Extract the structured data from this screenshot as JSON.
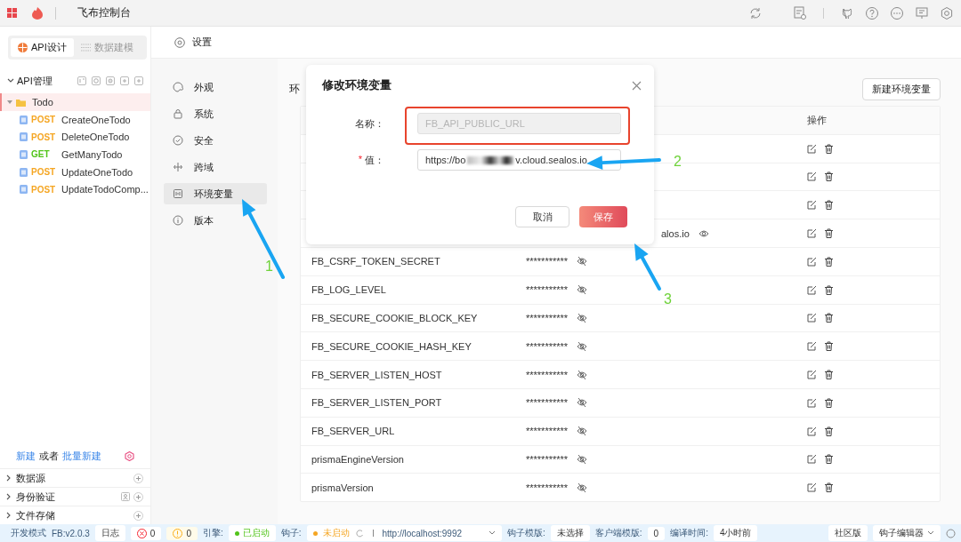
{
  "topbar": {
    "title": "飞布控制台"
  },
  "sidebar": {
    "tabs": [
      {
        "label": "API设计",
        "selected": true
      },
      {
        "label": "数据建模",
        "selected": false
      }
    ],
    "section": {
      "label": "API管理",
      "expanded": true
    },
    "tree": [
      {
        "label": "Todo",
        "selected": true,
        "expanded": true,
        "children": [
          {
            "method": "POST",
            "color": "#f5a623",
            "label": "CreateOneTodo",
            "selected": false
          },
          {
            "method": "POST",
            "color": "#f5a623",
            "label": "DeleteOneTodo",
            "selected": false
          },
          {
            "method": "GET",
            "color": "#52c41a",
            "label": "GetManyTodo",
            "selected": false
          },
          {
            "method": "POST",
            "color": "#f5a623",
            "label": "UpdateOneTodo",
            "selected": false
          },
          {
            "method": "POST",
            "color": "#f5a623",
            "label": "UpdateTodoComp..."
          }
        ]
      }
    ],
    "create_hint": {
      "link_1": "新建",
      "middle": "或者",
      "link_2": "批量新建"
    },
    "sections": [
      {
        "label": "数据源",
        "expanded": false,
        "kind": "plain"
      },
      {
        "label": "身份验证",
        "expanded": false,
        "kind": "user"
      },
      {
        "label": "文件存储",
        "expanded": false,
        "kind": "plain"
      }
    ]
  },
  "header": {
    "title": "设置"
  },
  "settings_nav": [
    {
      "label": "外观",
      "kind": "palette",
      "selected": false
    },
    {
      "label": "系统",
      "kind": "lock",
      "selected": false
    },
    {
      "label": "安全",
      "kind": "shield",
      "selected": false
    },
    {
      "label": "跨域",
      "kind": "cross",
      "selected": false
    },
    {
      "label": "环境变量",
      "kind": "env",
      "selected": true
    },
    {
      "label": "版本",
      "kind": "info",
      "selected": false
    }
  ],
  "table": {
    "title": "环",
    "new_button": "新建环境变量",
    "column_3": "操作",
    "rows": [
      {},
      {},
      {},
      {
        "value": "alos.io",
        "value_cut": true,
        "value_visible": true
      },
      {
        "name": "FB_CSRF_TOKEN_SECRET",
        "value": "***********",
        "value_visible": false
      },
      {
        "name": "FB_LOG_LEVEL",
        "value": "***********",
        "value_visible": false
      },
      {
        "name": "FB_SECURE_COOKIE_BLOCK_KEY",
        "value": "***********",
        "value_visible": false
      },
      {
        "name": "FB_SECURE_COOKIE_HASH_KEY",
        "value": "***********",
        "value_visible": false
      },
      {
        "name": "FB_SERVER_LISTEN_HOST",
        "value": "***********",
        "value_visible": false
      },
      {
        "name": "FB_SERVER_LISTEN_PORT",
        "value": "***********",
        "value_visible": false
      },
      {
        "name": "FB_SERVER_URL",
        "value": "***********",
        "value_visible": false
      },
      {
        "name": "prismaEngineVersion",
        "value": "***********",
        "value_visible": false
      },
      {
        "name": "prismaVersion",
        "value": "***********",
        "value_visible": false
      }
    ]
  },
  "modal": {
    "title": "修改环境变量",
    "name_label": "名称：",
    "name_value": "FB_API_PUBLIC_URL",
    "name_disabled": true,
    "value_label": "值：",
    "required_mark": "*",
    "value_start": "https://bo",
    "value_end": "v.cloud.sealos.io",
    "cancel": "取消",
    "save": "保存"
  },
  "status_bar": {
    "left": [
      {
        "kind": "label",
        "text": "开发模式"
      },
      {
        "kind": "label",
        "text": "FB:v2.0.3"
      },
      {
        "kind": "chip",
        "text": "日志"
      },
      {
        "kind": "error",
        "text": "0"
      },
      {
        "kind": "warning",
        "text": "0"
      },
      {
        "kind": "label",
        "text": "引擎:"
      },
      {
        "kind": "status",
        "text": "已启动",
        "color": "#52c41a"
      },
      {
        "kind": "label",
        "text": "钩子:"
      },
      {
        "kind": "hook",
        "text": "未启动",
        "color": "#f5a623",
        "url": "http://localhost:9992"
      },
      {
        "kind": "label",
        "text": "钩子模版:"
      },
      {
        "kind": "chip",
        "text": "未选择"
      },
      {
        "kind": "label",
        "text": "客户端模版:"
      },
      {
        "kind": "chip",
        "text": "0"
      },
      {
        "kind": "label",
        "text": "编译时间:"
      },
      {
        "kind": "chip",
        "text": "4小时前"
      }
    ],
    "right": [
      {
        "kind": "chip",
        "text": "社区版"
      },
      {
        "kind": "dropdown",
        "text": "钩子编辑器"
      }
    ]
  },
  "annotations": [
    {
      "label": "1"
    },
    {
      "label": "2"
    },
    {
      "label": "3"
    }
  ]
}
